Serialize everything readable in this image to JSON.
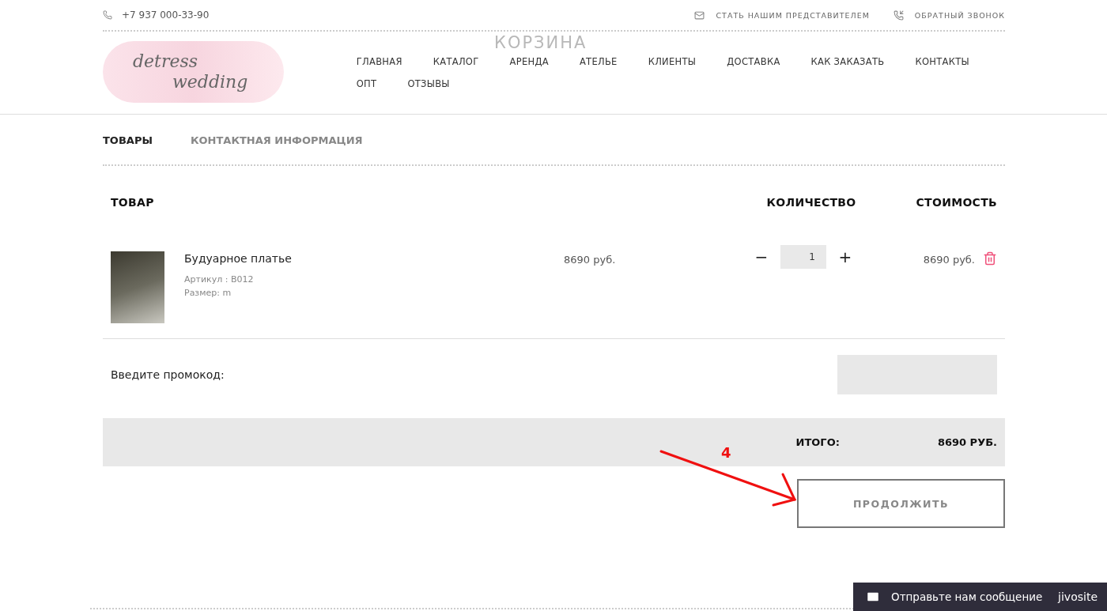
{
  "topbar": {
    "phone": "+7 937 000-33-90",
    "links": [
      "СТАТЬ НАШИМ ПРЕДСТАВИТЕЛЕМ",
      "ОБРАТНЫЙ ЗВОНОК"
    ]
  },
  "logo": {
    "line1": "detress",
    "line2": "wedding"
  },
  "page_title": "КОРЗИНА",
  "nav": [
    "ГЛАВНАЯ",
    "КАТАЛОГ",
    "АРЕНДА",
    "АТЕЛЬЕ",
    "КЛИЕНТЫ",
    "ДОСТАВКА",
    "КАК ЗАКАЗАТЬ",
    "КОНТАКТЫ",
    "ОПТ",
    "ОТЗЫВЫ"
  ],
  "tabs": [
    {
      "label": "ТОВАРЫ",
      "selected": true
    },
    {
      "label": "КОНТАКТНАЯ ИНФОРМАЦИЯ",
      "selected": false
    }
  ],
  "table": {
    "columns": [
      "ТОВАР",
      "КОЛИЧЕСТВО",
      "СТОИМОСТЬ"
    ],
    "rows": [
      {
        "name": "Будуарное платье",
        "article": "Артикул : B012",
        "size": "Размер: m",
        "price": "8690 руб.",
        "minus": "−",
        "quantity": "1",
        "plus": "+",
        "total": "8690 руб."
      }
    ]
  },
  "promo": {
    "label": "Введите промокод:"
  },
  "summary": {
    "label": "ИТОГО:",
    "value": "8690 РУБ."
  },
  "continue_button": "ПРОДОЛЖИТЬ",
  "annotation": {
    "label": "4"
  },
  "chat": {
    "text": "Отправьте нам сообщение",
    "brand": "jivosite"
  }
}
